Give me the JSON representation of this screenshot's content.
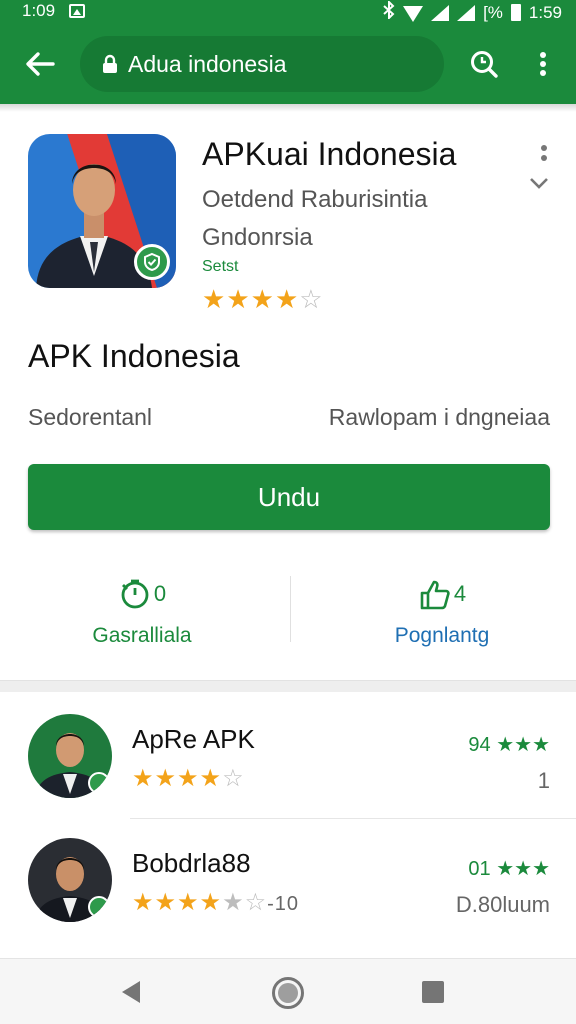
{
  "status_bar": {
    "time_left": "1:09",
    "battery_text": "[%",
    "time_right": "1:59"
  },
  "browser": {
    "url": "Adua indonesia"
  },
  "app": {
    "title": "APKuai Indonesia",
    "developer_line1": "Oetdend Raburisintia",
    "developer_line2": "Gndonrsia",
    "tag": "Setst",
    "rating": 3.5,
    "subtitle": "APK Indonesia",
    "meta_left": "Sedorentanl",
    "meta_right": "Rawlopam i dngneiaa",
    "install_label": "Undu"
  },
  "actions": {
    "left": {
      "count": "0",
      "label": "Gasralliala"
    },
    "right": {
      "count": "4",
      "label": "Pognlantg"
    }
  },
  "reviews": [
    {
      "name": "ApRe APK",
      "rating": 4,
      "score": "94 ★★★",
      "sub": "1"
    },
    {
      "name": "Bobdrla88",
      "rating": 4,
      "extra": "-10",
      "score": "01 ★★★",
      "sub": "D.80luum"
    }
  ],
  "colors": {
    "primary_green": "#1b8a3c",
    "star": "#f3a31a",
    "link_blue": "#1f6fb3"
  },
  "icons": {
    "back": "arrow-left-icon",
    "lock": "lock-icon",
    "search": "search-icon",
    "menu": "more-vert-icon"
  }
}
